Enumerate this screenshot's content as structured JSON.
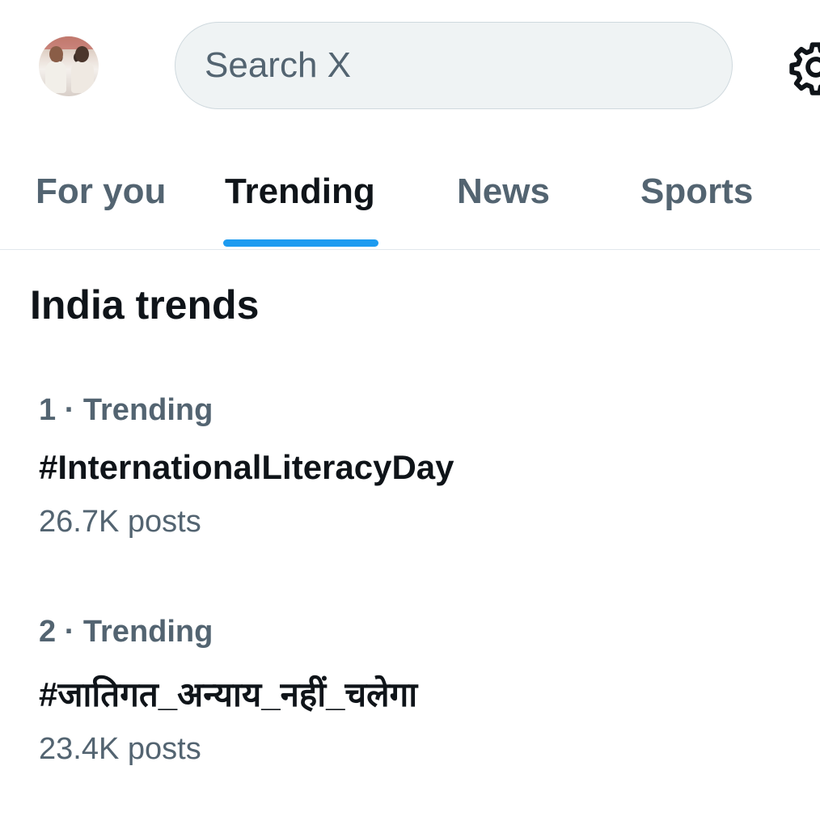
{
  "header": {
    "search_placeholder": "Search X"
  },
  "tabs": [
    {
      "label": "For you",
      "active": false
    },
    {
      "label": "Trending",
      "active": true
    },
    {
      "label": "News",
      "active": false
    },
    {
      "label": "Sports",
      "active": false
    }
  ],
  "section_title": "India trends",
  "trends": [
    {
      "rank": "1",
      "context": "Trending",
      "meta": "1 · Trending",
      "name": "#InternationalLiteracyDay",
      "posts": "26.7K posts"
    },
    {
      "rank": "2",
      "context": "Trending",
      "meta": "2 · Trending",
      "name": "#जातिगत_अन्याय_नहीं_चलेगा",
      "posts": "23.4K posts"
    }
  ],
  "colors": {
    "accent": "#1d9bf0",
    "secondary_text": "#536471",
    "primary_text": "#0f1419",
    "search_bg": "#eff3f4"
  },
  "icons": {
    "settings": "gear-icon",
    "profile": "avatar"
  }
}
